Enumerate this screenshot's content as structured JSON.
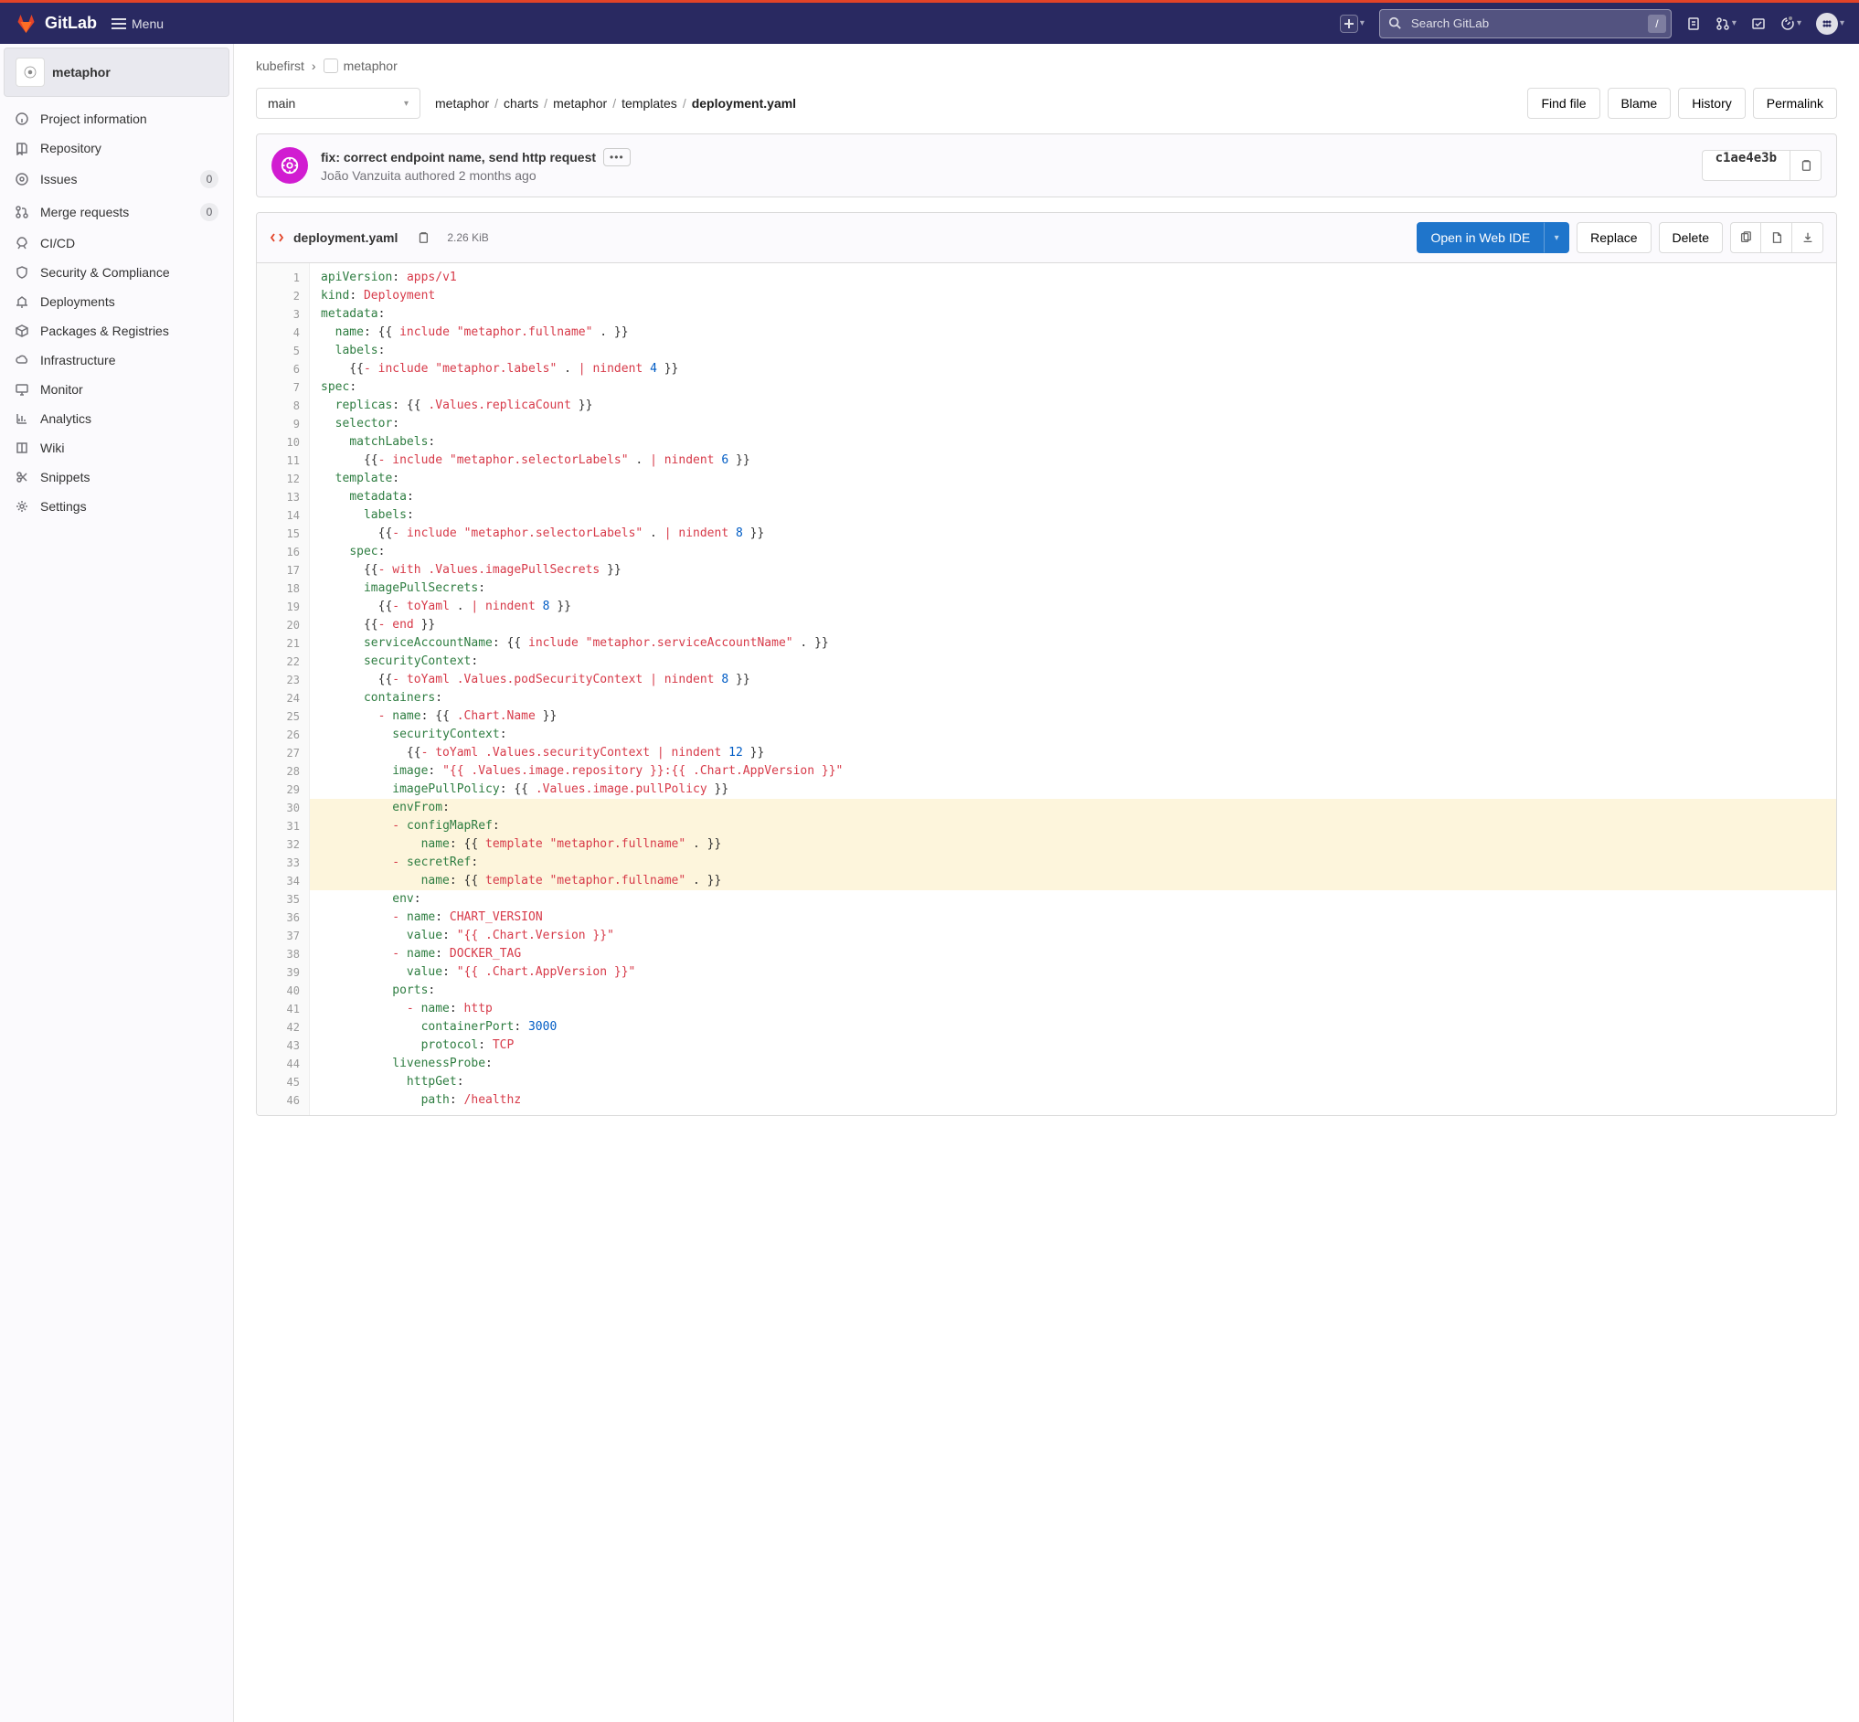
{
  "header": {
    "logo_text": "GitLab",
    "menu_label": "Menu",
    "search_placeholder": "Search GitLab",
    "kbd": "/"
  },
  "sidebar": {
    "project_name": "metaphor",
    "items": [
      {
        "label": "Project information",
        "icon": "info"
      },
      {
        "label": "Repository",
        "icon": "repo"
      },
      {
        "label": "Issues",
        "icon": "issues",
        "badge": "0"
      },
      {
        "label": "Merge requests",
        "icon": "mr",
        "badge": "0"
      },
      {
        "label": "CI/CD",
        "icon": "rocket"
      },
      {
        "label": "Security & Compliance",
        "icon": "shield"
      },
      {
        "label": "Deployments",
        "icon": "deploy"
      },
      {
        "label": "Packages & Registries",
        "icon": "package"
      },
      {
        "label": "Infrastructure",
        "icon": "cloud"
      },
      {
        "label": "Monitor",
        "icon": "monitor"
      },
      {
        "label": "Analytics",
        "icon": "chart"
      },
      {
        "label": "Wiki",
        "icon": "book"
      },
      {
        "label": "Snippets",
        "icon": "scissors"
      },
      {
        "label": "Settings",
        "icon": "gear"
      }
    ]
  },
  "breadcrumbs": {
    "group": "kubefirst",
    "project": "metaphor"
  },
  "file_nav": {
    "branch": "main",
    "path_segments": [
      "metaphor",
      "charts",
      "metaphor",
      "templates",
      "deployment.yaml"
    ],
    "actions": {
      "find": "Find file",
      "blame": "Blame",
      "history": "History",
      "permalink": "Permalink"
    }
  },
  "commit": {
    "title": "fix: correct endpoint name, send http request",
    "author": "João Vanzuita",
    "verb": "authored",
    "when": "2 months ago",
    "sha": "c1ae4e3b"
  },
  "file": {
    "name": "deployment.yaml",
    "size": "2.26 KiB",
    "ide_button": "Open in Web IDE",
    "replace": "Replace",
    "delete": "Delete"
  },
  "code": {
    "highlight_start": 30,
    "highlight_end": 34,
    "lines": [
      [
        [
          "k",
          "apiVersion"
        ],
        [
          "p",
          ":"
        ],
        [
          "p",
          " "
        ],
        [
          "s",
          "apps/v1"
        ]
      ],
      [
        [
          "k",
          "kind"
        ],
        [
          "p",
          ":"
        ],
        [
          "p",
          " "
        ],
        [
          "s",
          "Deployment"
        ]
      ],
      [
        [
          "k",
          "metadata"
        ],
        [
          "p",
          ":"
        ]
      ],
      [
        [
          "p",
          "  "
        ],
        [
          "k",
          "name"
        ],
        [
          "p",
          ":"
        ],
        [
          "p",
          " {{ "
        ],
        [
          "s",
          "include"
        ],
        [
          "p",
          " "
        ],
        [
          "s",
          "\"metaphor.fullname\""
        ],
        [
          "p",
          " . }}"
        ]
      ],
      [
        [
          "p",
          "  "
        ],
        [
          "k",
          "labels"
        ],
        [
          "p",
          ":"
        ]
      ],
      [
        [
          "p",
          "    {{"
        ],
        [
          "s",
          "-"
        ],
        [
          "p",
          " "
        ],
        [
          "s",
          "include"
        ],
        [
          "p",
          " "
        ],
        [
          "s",
          "\"metaphor.labels\""
        ],
        [
          "p",
          " . "
        ],
        [
          "s",
          "|"
        ],
        [
          "p",
          " "
        ],
        [
          "s",
          "nindent"
        ],
        [
          "p",
          " "
        ],
        [
          "n",
          "4"
        ],
        [
          "p",
          " }}"
        ]
      ],
      [
        [
          "k",
          "spec"
        ],
        [
          "p",
          ":"
        ]
      ],
      [
        [
          "p",
          "  "
        ],
        [
          "k",
          "replicas"
        ],
        [
          "p",
          ":"
        ],
        [
          "p",
          " {{ "
        ],
        [
          "s",
          ".Values.replicaCount"
        ],
        [
          "p",
          " }}"
        ]
      ],
      [
        [
          "p",
          "  "
        ],
        [
          "k",
          "selector"
        ],
        [
          "p",
          ":"
        ]
      ],
      [
        [
          "p",
          "    "
        ],
        [
          "k",
          "matchLabels"
        ],
        [
          "p",
          ":"
        ]
      ],
      [
        [
          "p",
          "      {{"
        ],
        [
          "s",
          "-"
        ],
        [
          "p",
          " "
        ],
        [
          "s",
          "include"
        ],
        [
          "p",
          " "
        ],
        [
          "s",
          "\"metaphor.selectorLabels\""
        ],
        [
          "p",
          " . "
        ],
        [
          "s",
          "|"
        ],
        [
          "p",
          " "
        ],
        [
          "s",
          "nindent"
        ],
        [
          "p",
          " "
        ],
        [
          "n",
          "6"
        ],
        [
          "p",
          " }}"
        ]
      ],
      [
        [
          "p",
          "  "
        ],
        [
          "k",
          "template"
        ],
        [
          "p",
          ":"
        ]
      ],
      [
        [
          "p",
          "    "
        ],
        [
          "k",
          "metadata"
        ],
        [
          "p",
          ":"
        ]
      ],
      [
        [
          "p",
          "      "
        ],
        [
          "k",
          "labels"
        ],
        [
          "p",
          ":"
        ]
      ],
      [
        [
          "p",
          "        {{"
        ],
        [
          "s",
          "-"
        ],
        [
          "p",
          " "
        ],
        [
          "s",
          "include"
        ],
        [
          "p",
          " "
        ],
        [
          "s",
          "\"metaphor.selectorLabels\""
        ],
        [
          "p",
          " . "
        ],
        [
          "s",
          "|"
        ],
        [
          "p",
          " "
        ],
        [
          "s",
          "nindent"
        ],
        [
          "p",
          " "
        ],
        [
          "n",
          "8"
        ],
        [
          "p",
          " }}"
        ]
      ],
      [
        [
          "p",
          "    "
        ],
        [
          "k",
          "spec"
        ],
        [
          "p",
          ":"
        ]
      ],
      [
        [
          "p",
          "      {{"
        ],
        [
          "s",
          "-"
        ],
        [
          "p",
          " "
        ],
        [
          "s",
          "with"
        ],
        [
          "p",
          " "
        ],
        [
          "s",
          ".Values.imagePullSecrets"
        ],
        [
          "p",
          " }}"
        ]
      ],
      [
        [
          "p",
          "      "
        ],
        [
          "k",
          "imagePullSecrets"
        ],
        [
          "p",
          ":"
        ]
      ],
      [
        [
          "p",
          "        {{"
        ],
        [
          "s",
          "-"
        ],
        [
          "p",
          " "
        ],
        [
          "s",
          "toYaml"
        ],
        [
          "p",
          " . "
        ],
        [
          "s",
          "|"
        ],
        [
          "p",
          " "
        ],
        [
          "s",
          "nindent"
        ],
        [
          "p",
          " "
        ],
        [
          "n",
          "8"
        ],
        [
          "p",
          " }}"
        ]
      ],
      [
        [
          "p",
          "      {{"
        ],
        [
          "s",
          "-"
        ],
        [
          "p",
          " "
        ],
        [
          "s",
          "end"
        ],
        [
          "p",
          " }}"
        ]
      ],
      [
        [
          "p",
          "      "
        ],
        [
          "k",
          "serviceAccountName"
        ],
        [
          "p",
          ":"
        ],
        [
          "p",
          " {{ "
        ],
        [
          "s",
          "include"
        ],
        [
          "p",
          " "
        ],
        [
          "s",
          "\"metaphor.serviceAccountName\""
        ],
        [
          "p",
          " . }}"
        ]
      ],
      [
        [
          "p",
          "      "
        ],
        [
          "k",
          "securityContext"
        ],
        [
          "p",
          ":"
        ]
      ],
      [
        [
          "p",
          "        {{"
        ],
        [
          "s",
          "-"
        ],
        [
          "p",
          " "
        ],
        [
          "s",
          "toYaml"
        ],
        [
          "p",
          " "
        ],
        [
          "s",
          ".Values.podSecurityContext"
        ],
        [
          "p",
          " "
        ],
        [
          "s",
          "|"
        ],
        [
          "p",
          " "
        ],
        [
          "s",
          "nindent"
        ],
        [
          "p",
          " "
        ],
        [
          "n",
          "8"
        ],
        [
          "p",
          " }}"
        ]
      ],
      [
        [
          "p",
          "      "
        ],
        [
          "k",
          "containers"
        ],
        [
          "p",
          ":"
        ]
      ],
      [
        [
          "p",
          "        "
        ],
        [
          "s",
          "-"
        ],
        [
          "p",
          " "
        ],
        [
          "k",
          "name"
        ],
        [
          "p",
          ":"
        ],
        [
          "p",
          " {{ "
        ],
        [
          "s",
          ".Chart.Name"
        ],
        [
          "p",
          " }}"
        ]
      ],
      [
        [
          "p",
          "          "
        ],
        [
          "k",
          "securityContext"
        ],
        [
          "p",
          ":"
        ]
      ],
      [
        [
          "p",
          "            {{"
        ],
        [
          "s",
          "-"
        ],
        [
          "p",
          " "
        ],
        [
          "s",
          "toYaml"
        ],
        [
          "p",
          " "
        ],
        [
          "s",
          ".Values.securityContext"
        ],
        [
          "p",
          " "
        ],
        [
          "s",
          "|"
        ],
        [
          "p",
          " "
        ],
        [
          "s",
          "nindent"
        ],
        [
          "p",
          " "
        ],
        [
          "n",
          "12"
        ],
        [
          "p",
          " }}"
        ]
      ],
      [
        [
          "p",
          "          "
        ],
        [
          "k",
          "image"
        ],
        [
          "p",
          ":"
        ],
        [
          "p",
          " "
        ],
        [
          "s",
          "\"{{ .Values.image.repository }}:{{ .Chart.AppVersion }}\""
        ]
      ],
      [
        [
          "p",
          "          "
        ],
        [
          "k",
          "imagePullPolicy"
        ],
        [
          "p",
          ":"
        ],
        [
          "p",
          " {{ "
        ],
        [
          "s",
          ".Values.image.pullPolicy"
        ],
        [
          "p",
          " }}"
        ]
      ],
      [
        [
          "p",
          "          "
        ],
        [
          "k",
          "envFrom"
        ],
        [
          "p",
          ":"
        ]
      ],
      [
        [
          "p",
          "          "
        ],
        [
          "s",
          "-"
        ],
        [
          "p",
          " "
        ],
        [
          "k",
          "configMapRef"
        ],
        [
          "p",
          ":"
        ]
      ],
      [
        [
          "p",
          "              "
        ],
        [
          "k",
          "name"
        ],
        [
          "p",
          ":"
        ],
        [
          "p",
          " {{ "
        ],
        [
          "s",
          "template"
        ],
        [
          "p",
          " "
        ],
        [
          "s",
          "\"metaphor.fullname\""
        ],
        [
          "p",
          " . }}"
        ]
      ],
      [
        [
          "p",
          "          "
        ],
        [
          "s",
          "-"
        ],
        [
          "p",
          " "
        ],
        [
          "k",
          "secretRef"
        ],
        [
          "p",
          ":"
        ]
      ],
      [
        [
          "p",
          "              "
        ],
        [
          "k",
          "name"
        ],
        [
          "p",
          ":"
        ],
        [
          "p",
          " {{ "
        ],
        [
          "s",
          "template"
        ],
        [
          "p",
          " "
        ],
        [
          "s",
          "\"metaphor.fullname\""
        ],
        [
          "p",
          " . }}"
        ]
      ],
      [
        [
          "p",
          "          "
        ],
        [
          "k",
          "env"
        ],
        [
          "p",
          ":"
        ]
      ],
      [
        [
          "p",
          "          "
        ],
        [
          "s",
          "-"
        ],
        [
          "p",
          " "
        ],
        [
          "k",
          "name"
        ],
        [
          "p",
          ":"
        ],
        [
          "p",
          " "
        ],
        [
          "s",
          "CHART_VERSION"
        ]
      ],
      [
        [
          "p",
          "            "
        ],
        [
          "k",
          "value"
        ],
        [
          "p",
          ":"
        ],
        [
          "p",
          " "
        ],
        [
          "s",
          "\"{{ .Chart.Version }}\""
        ]
      ],
      [
        [
          "p",
          "          "
        ],
        [
          "s",
          "-"
        ],
        [
          "p",
          " "
        ],
        [
          "k",
          "name"
        ],
        [
          "p",
          ":"
        ],
        [
          "p",
          " "
        ],
        [
          "s",
          "DOCKER_TAG"
        ]
      ],
      [
        [
          "p",
          "            "
        ],
        [
          "k",
          "value"
        ],
        [
          "p",
          ":"
        ],
        [
          "p",
          " "
        ],
        [
          "s",
          "\"{{ .Chart.AppVersion }}\""
        ]
      ],
      [
        [
          "p",
          "          "
        ],
        [
          "k",
          "ports"
        ],
        [
          "p",
          ":"
        ]
      ],
      [
        [
          "p",
          "            "
        ],
        [
          "s",
          "-"
        ],
        [
          "p",
          " "
        ],
        [
          "k",
          "name"
        ],
        [
          "p",
          ":"
        ],
        [
          "p",
          " "
        ],
        [
          "s",
          "http"
        ]
      ],
      [
        [
          "p",
          "              "
        ],
        [
          "k",
          "containerPort"
        ],
        [
          "p",
          ":"
        ],
        [
          "p",
          " "
        ],
        [
          "n",
          "3000"
        ]
      ],
      [
        [
          "p",
          "              "
        ],
        [
          "k",
          "protocol"
        ],
        [
          "p",
          ":"
        ],
        [
          "p",
          " "
        ],
        [
          "s",
          "TCP"
        ]
      ],
      [
        [
          "p",
          "          "
        ],
        [
          "k",
          "livenessProbe"
        ],
        [
          "p",
          ":"
        ]
      ],
      [
        [
          "p",
          "            "
        ],
        [
          "k",
          "httpGet"
        ],
        [
          "p",
          ":"
        ]
      ],
      [
        [
          "p",
          "              "
        ],
        [
          "k",
          "path"
        ],
        [
          "p",
          ":"
        ],
        [
          "p",
          " "
        ],
        [
          "s",
          "/healthz"
        ]
      ]
    ]
  }
}
